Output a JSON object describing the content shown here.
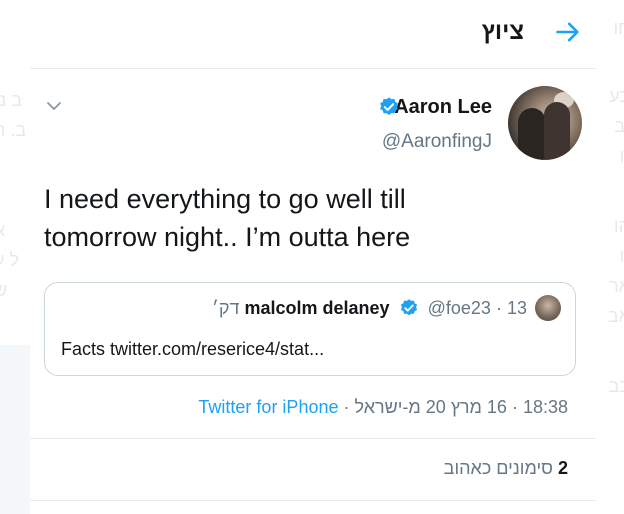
{
  "header": {
    "title": "ציוץ",
    "back_icon": "arrow-right-icon"
  },
  "tweet": {
    "author_name": "Aaron Lee",
    "author_handle": "@AaronfingJ",
    "text": "I need everything to go well till\ntomorrow night.. I’m outta here",
    "quote": {
      "author_name": "malcolm delaney",
      "author_handle": "@foe23",
      "separator": "·",
      "time": "13 דק׳",
      "text": "Facts twitter.com/reserice4/stat..."
    },
    "meta": {
      "time": "18:38",
      "separator": "·",
      "date": "16 מרץ 20 מ-ישראל",
      "source": "Twitter for iPhone"
    },
    "likes": {
      "count": "2",
      "label": "סימונים כאהוב"
    }
  },
  "colors": {
    "accent": "#1da1f2",
    "secondary_text": "#657786",
    "border": "#ccd6dd"
  }
}
